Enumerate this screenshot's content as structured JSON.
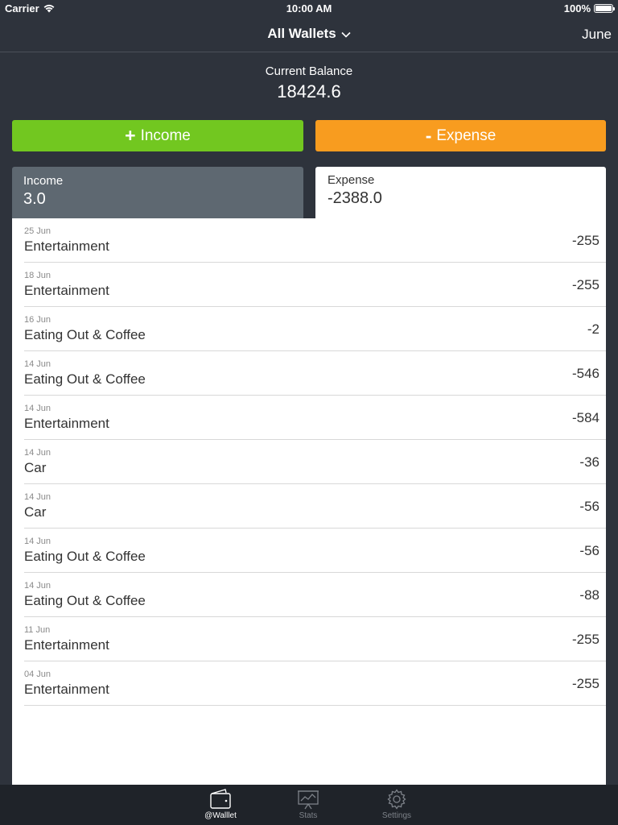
{
  "status_bar": {
    "carrier": "Carrier",
    "time": "10:00 AM",
    "battery": "100%"
  },
  "nav": {
    "title": "All Wallets",
    "month": "June"
  },
  "balance": {
    "label": "Current Balance",
    "value": "18424.6"
  },
  "actions": {
    "income_sign": "+",
    "income_label": "Income",
    "expense_sign": "-",
    "expense_label": "Expense"
  },
  "summary": {
    "income_label": "Income",
    "income_value": "3.0",
    "expense_label": "Expense",
    "expense_value": "-2388.0"
  },
  "transactions": [
    {
      "date": "25 Jun",
      "category": "Entertainment",
      "amount": "-255"
    },
    {
      "date": "18 Jun",
      "category": "Entertainment",
      "amount": "-255"
    },
    {
      "date": "16 Jun",
      "category": "Eating Out & Coffee",
      "amount": "-2"
    },
    {
      "date": "14 Jun",
      "category": "Eating Out & Coffee",
      "amount": "-546"
    },
    {
      "date": "14 Jun",
      "category": "Entertainment",
      "amount": "-584"
    },
    {
      "date": "14 Jun",
      "category": "Car",
      "amount": "-36"
    },
    {
      "date": "14 Jun",
      "category": "Car",
      "amount": "-56"
    },
    {
      "date": "14 Jun",
      "category": "Eating Out & Coffee",
      "amount": "-56"
    },
    {
      "date": "14 Jun",
      "category": "Eating Out & Coffee",
      "amount": "-88"
    },
    {
      "date": "11 Jun",
      "category": "Entertainment",
      "amount": "-255"
    },
    {
      "date": "04 Jun",
      "category": "Entertainment",
      "amount": "-255"
    }
  ],
  "tabbar": {
    "wallet_label": "@Walllet",
    "stats_label": "Stats",
    "settings_label": "Settings"
  },
  "colors": {
    "background": "#2e333c",
    "income": "#72c720",
    "expense": "#f89c1f",
    "income_tab": "#5e6871"
  }
}
